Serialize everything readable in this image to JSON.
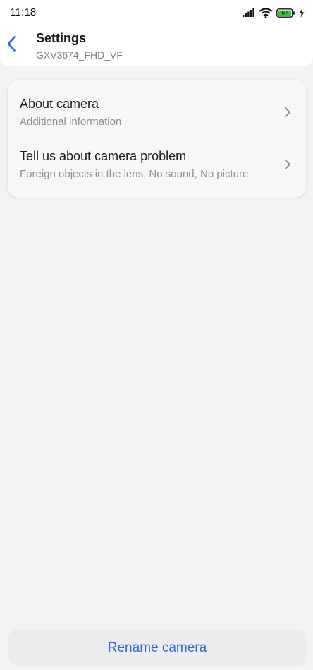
{
  "status_bar": {
    "time": "11:18",
    "battery_level": "67",
    "icons": [
      "signal-icon",
      "wifi-icon",
      "battery-icon",
      "charging-icon"
    ]
  },
  "header": {
    "back_icon": "chevron-left-icon",
    "title": "Settings",
    "subtitle": "GXV3674_FHD_VF"
  },
  "menu": {
    "items": [
      {
        "title": "About camera",
        "subtitle": "Additional information",
        "icon": "chevron-right-icon"
      },
      {
        "title": "Tell us about camera problem",
        "subtitle": "Foreign objects in the lens, No sound, No picture",
        "icon": "chevron-right-icon"
      }
    ]
  },
  "footer": {
    "rename_label": "Rename camera"
  },
  "colors": {
    "accent": "#2f66e0",
    "background": "#f3f3f3",
    "battery": "#3ec23e"
  }
}
